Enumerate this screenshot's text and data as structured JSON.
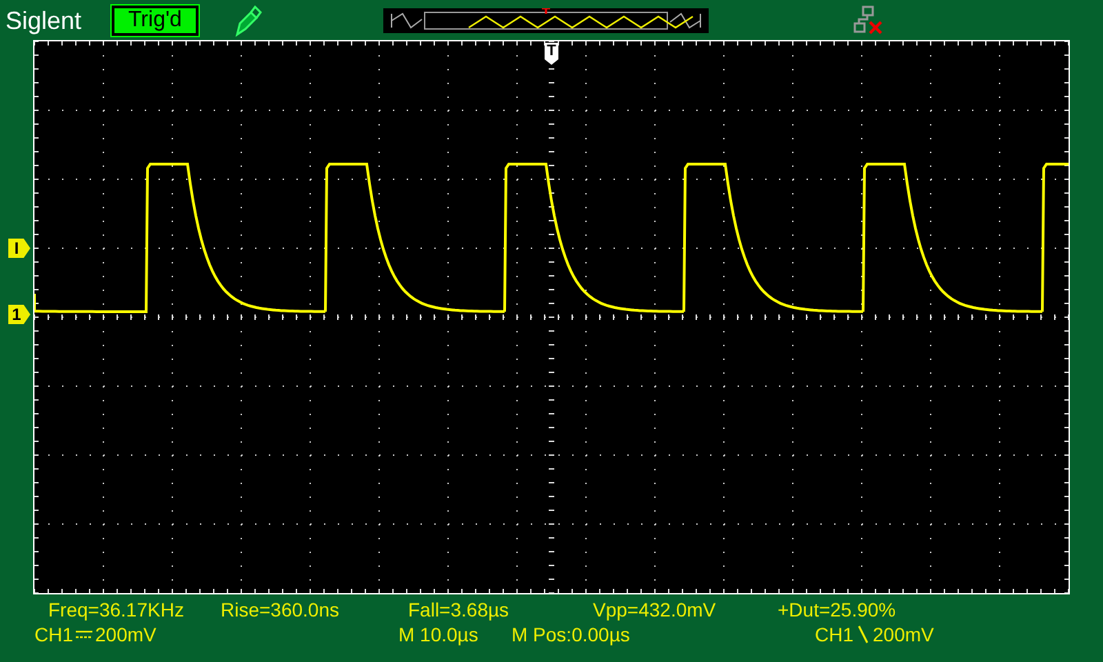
{
  "header": {
    "brand": "Siglent",
    "trigger_status": "Trig'd"
  },
  "markers": {
    "trigger_position": "T",
    "trigger_level": "I",
    "channel": "1"
  },
  "measurements": [
    "Freq=36.17KHz",
    "Rise=360.0ns",
    "Fall=3.68µs",
    "Vpp=432.0mV",
    "+Dut=25.90%"
  ],
  "channel": {
    "name": "CH1",
    "scale": "200mV"
  },
  "timebase": {
    "scale": "M 10.0µs",
    "position": "M Pos:0.00µs"
  },
  "trigger": {
    "source": "CH1",
    "level": "200mV"
  }
}
